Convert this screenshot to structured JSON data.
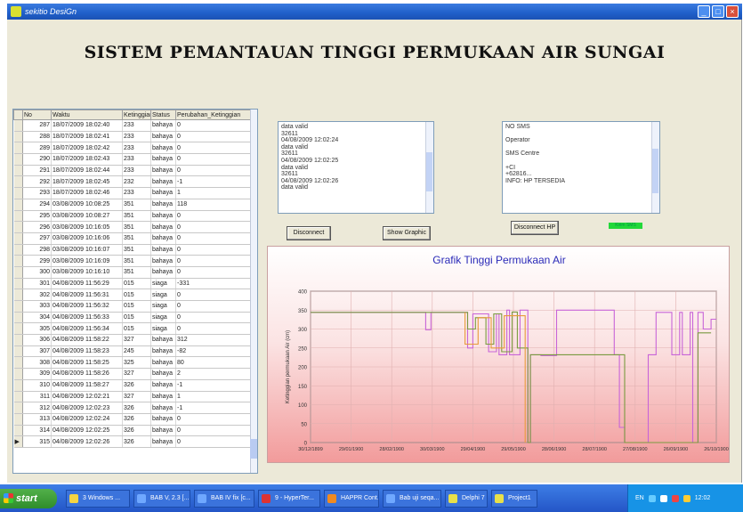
{
  "window": {
    "title": "sekitio DesiGn",
    "buttons": {
      "minimize": "_",
      "maximize": "□",
      "close": "×"
    }
  },
  "heading": "SISTEM PEMANTAUAN TINGGI PERMUKAAN AIR SUNGAI",
  "grid": {
    "columns": [
      "No",
      "Waktu",
      "Ketinggian",
      "Status",
      "Perubahan_Ketinggian"
    ],
    "rows": [
      [
        "287",
        "18/07/2009 18:02:40",
        "233",
        "bahaya",
        "0"
      ],
      [
        "288",
        "18/07/2009 18:02:41",
        "233",
        "bahaya",
        "0"
      ],
      [
        "289",
        "18/07/2009 18:02:42",
        "233",
        "bahaya",
        "0"
      ],
      [
        "290",
        "18/07/2009 18:02:43",
        "233",
        "bahaya",
        "0"
      ],
      [
        "291",
        "18/07/2009 18:02:44",
        "233",
        "bahaya",
        "0"
      ],
      [
        "292",
        "18/07/2009 18:02:45",
        "232",
        "bahaya",
        "-1"
      ],
      [
        "293",
        "18/07/2009 18:02:46",
        "233",
        "bahaya",
        "1"
      ],
      [
        "294",
        "03/08/2009 10:08:25",
        "351",
        "bahaya",
        "118"
      ],
      [
        "295",
        "03/08/2009 10:08:27",
        "351",
        "bahaya",
        "0"
      ],
      [
        "296",
        "03/08/2009 10:16:05",
        "351",
        "bahaya",
        "0"
      ],
      [
        "297",
        "03/08/2009 10:16:06",
        "351",
        "bahaya",
        "0"
      ],
      [
        "298",
        "03/08/2009 10:16:07",
        "351",
        "bahaya",
        "0"
      ],
      [
        "299",
        "03/08/2009 10:16:09",
        "351",
        "bahaya",
        "0"
      ],
      [
        "300",
        "03/08/2009 10:16:10",
        "351",
        "bahaya",
        "0"
      ],
      [
        "301",
        "04/08/2009 11:56:29",
        "015",
        "siaga",
        "-331"
      ],
      [
        "302",
        "04/08/2009 11:56:31",
        "015",
        "siaga",
        "0"
      ],
      [
        "303",
        "04/08/2009 11:56:32",
        "015",
        "siaga",
        "0"
      ],
      [
        "304",
        "04/08/2009 11:56:33",
        "015",
        "siaga",
        "0"
      ],
      [
        "305",
        "04/08/2009 11:56:34",
        "015",
        "siaga",
        "0"
      ],
      [
        "306",
        "04/08/2009 11:58:22",
        "327",
        "bahaya",
        "312"
      ],
      [
        "307",
        "04/08/2009 11:58:23",
        "245",
        "bahaya",
        "-82"
      ],
      [
        "308",
        "04/08/2009 11:58:25",
        "325",
        "bahaya",
        "80"
      ],
      [
        "309",
        "04/08/2009 11:58:26",
        "327",
        "bahaya",
        "2"
      ],
      [
        "310",
        "04/08/2009 11:58:27",
        "326",
        "bahaya",
        "-1"
      ],
      [
        "311",
        "04/08/2009 12:02:21",
        "327",
        "bahaya",
        "1"
      ],
      [
        "312",
        "04/08/2009 12:02:23",
        "326",
        "bahaya",
        "-1"
      ],
      [
        "313",
        "04/08/2009 12:02:24",
        "326",
        "bahaya",
        "0"
      ],
      [
        "314",
        "04/08/2009 12:02:25",
        "326",
        "bahaya",
        "0"
      ],
      [
        "315",
        "04/08/2009 12:02:26",
        "326",
        "bahaya",
        "0"
      ]
    ],
    "current_row_marker": "▶"
  },
  "memo_left": {
    "lines": [
      "data valid",
      "32611",
      "04/08/2009 12:02:24",
      "data valid",
      "32611",
      "04/08/2009 12:02:25",
      "data valid",
      "32611",
      "04/08/2009 12:02:26",
      "data valid"
    ]
  },
  "memo_right": {
    "lines": [
      "NO SMS",
      "",
      "Operator",
      "",
      "SMS Centre",
      "",
      "+CI",
      "+62816...",
      "INFO: HP TERSEDIA"
    ]
  },
  "buttons": {
    "disconnect": "Disconnect",
    "show_graphic": "Show Graphic",
    "disconnect_hp": "Disconnect HP"
  },
  "status_led": "Kirim SMS",
  "chart_data": {
    "type": "line",
    "title": "Grafik Tinggi Permukaan Air",
    "ylabel": "Ketinggian permukaan Air (cm)",
    "xlabel": "",
    "ylim": [
      0,
      400
    ],
    "y_ticks": [
      "0",
      "50",
      "100",
      "150",
      "200",
      "250",
      "300",
      "350",
      "400"
    ],
    "x_tick_labels": [
      "30/12/1899",
      "29/01/1900",
      "28/02/1900",
      "30/03/1900",
      "29/04/1900",
      "29/05/1900",
      "28/06/1900",
      "28/07/1900",
      "27/08/1900",
      "26/09/1900",
      "26/10/1900"
    ],
    "xlim": [
      0,
      310
    ],
    "grid": true,
    "legend": "none",
    "series": [
      {
        "color": "#c864d8",
        "x": [
          0,
          88,
          88,
          92,
          92,
          120,
          120,
          124,
          124,
          136,
          136,
          142,
          142,
          144,
          144,
          150,
          150,
          152,
          152,
          160,
          160,
          166,
          166,
          168,
          168,
          176,
          176,
          188,
          188,
          232,
          232,
          236,
          236,
          240,
          240,
          258,
          258,
          264,
          264,
          276,
          276,
          282,
          282,
          284,
          284,
          290,
          290,
          292,
          292,
          296,
          296,
          300,
          300,
          306,
          306,
          310
        ],
        "y": [
          344,
          344,
          298,
          298,
          344,
          344,
          250,
          250,
          340,
          340,
          240,
          240,
          340,
          340,
          232,
          232,
          350,
          350,
          232,
          232,
          350,
          350,
          0,
          0,
          232,
          232,
          230,
          230,
          350,
          350,
          232,
          232,
          40,
          40,
          0,
          0,
          232,
          232,
          344,
          344,
          232,
          232,
          344,
          344,
          232,
          232,
          344,
          344,
          0,
          0,
          344,
          344,
          300,
          300,
          326,
          326
        ]
      },
      {
        "color": "#7a9a40",
        "x": [
          0,
          120,
          120,
          126,
          126,
          134,
          134,
          140,
          140,
          146,
          146,
          154,
          154,
          158,
          158,
          166,
          166,
          168,
          168,
          240,
          240,
          296,
          296,
          306
        ],
        "y": [
          344,
          344,
          300,
          300,
          330,
          330,
          260,
          260,
          340,
          340,
          240,
          240,
          345,
          345,
          250,
          250,
          0,
          0,
          232,
          232,
          0,
          0,
          290,
          290
        ]
      },
      {
        "color": "#e89a3a",
        "x": [
          118,
          118,
          128,
          128,
          138,
          138,
          148,
          148,
          164,
          164
        ],
        "y": [
          344,
          260,
          260,
          330,
          330,
          250,
          250,
          335,
          335,
          0
        ]
      }
    ]
  },
  "taskbar": {
    "start": "start",
    "tasks": [
      "3 Windows ...",
      "BAB V, 2.3 [...",
      "BAB IV fix [c...",
      "9 - HyperTer...",
      "HAPPR Cont...",
      "Bab uji seqa...",
      "Delphi 7",
      "Project1"
    ],
    "tray_lang": "EN",
    "clock": "12:02"
  },
  "colors": {
    "titlebar": "#1f5fc9",
    "client_bg": "#ece9d8",
    "chart_title": "#2a2ab8",
    "taskbar": "#2455c7"
  }
}
